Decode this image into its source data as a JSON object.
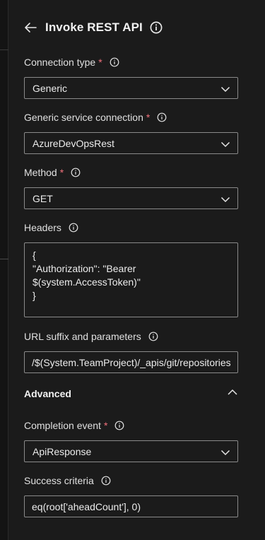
{
  "header": {
    "title": "Invoke REST API",
    "back_icon": "arrow-left-icon",
    "info_icon": "info-icon"
  },
  "fields": {
    "connection_type": {
      "label": "Connection type",
      "required": "*",
      "value": "Generic"
    },
    "service_connection": {
      "label": "Generic service connection",
      "required": "*",
      "value": "AzureDevOpsRest"
    },
    "method": {
      "label": "Method",
      "required": "*",
      "value": "GET"
    },
    "headers": {
      "label": "Headers",
      "lines": [
        "{",
        "\"Authorization\": \"Bearer",
        "$(system.AccessToken)\"",
        "}"
      ]
    },
    "url_suffix": {
      "label": "URL suffix and parameters",
      "value": "/$(System.TeamProject)/_apis/git/repositories"
    },
    "advanced": {
      "label": "Advanced"
    },
    "completion_event": {
      "label": "Completion event",
      "required": "*",
      "value": "ApiResponse"
    },
    "success_criteria": {
      "label": "Success criteria",
      "value": "eq(root['aheadCount'], 0)"
    }
  },
  "colors": {
    "background": "#1b1b1b",
    "border": "#8a8a8a",
    "required": "#f1707b",
    "text": "#e6e6e6"
  }
}
